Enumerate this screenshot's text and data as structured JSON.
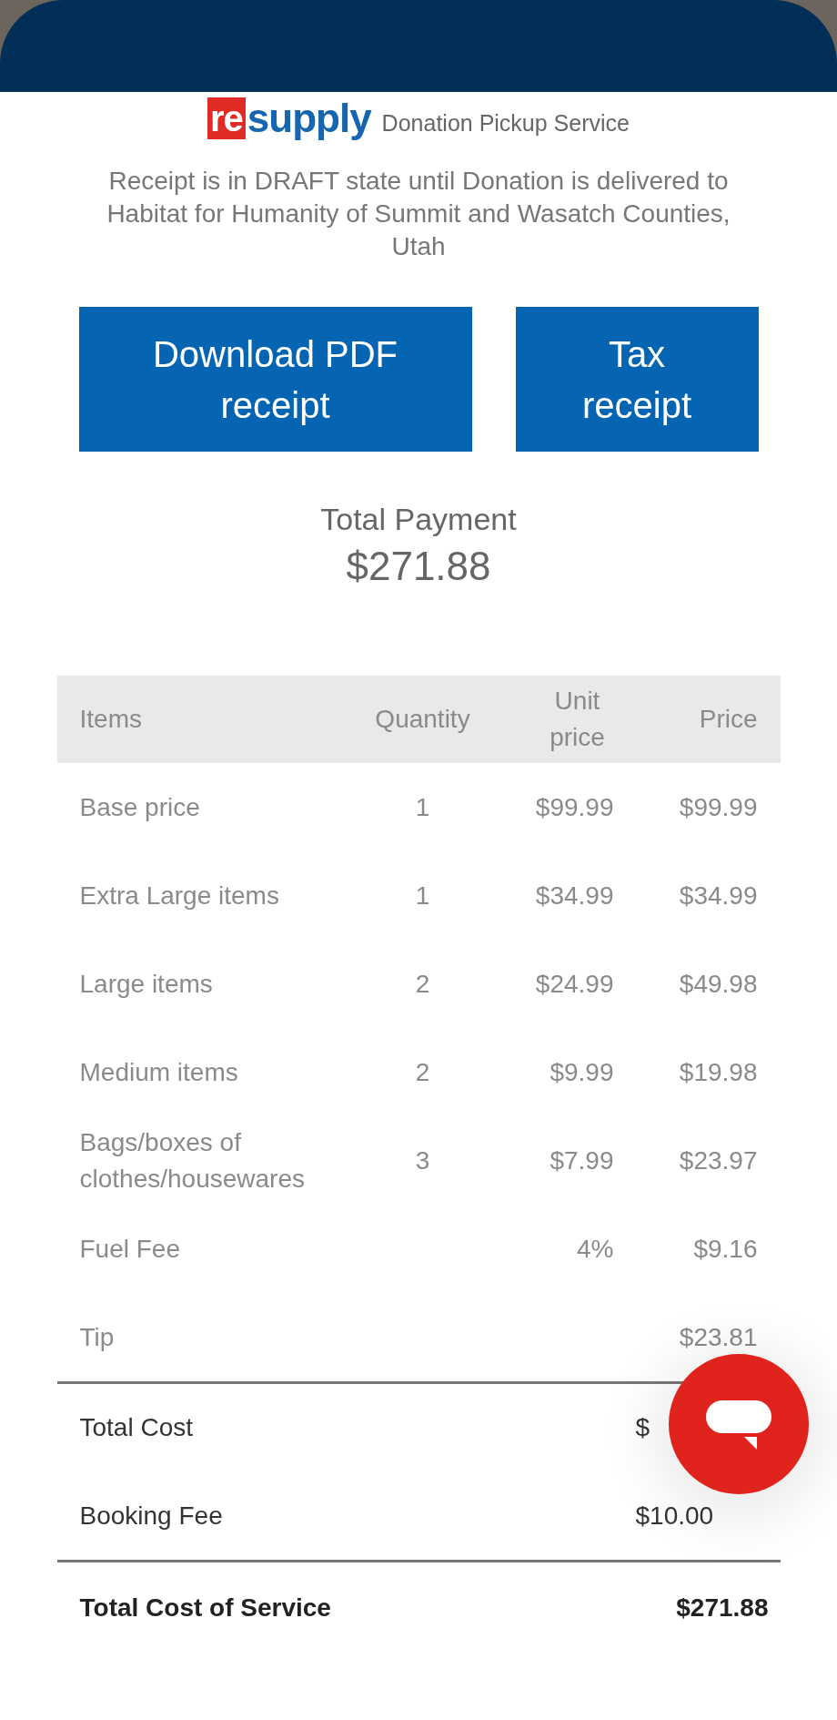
{
  "logo": {
    "mark": "re",
    "word": "supply",
    "tagline": "Donation Pickup Service"
  },
  "notice": "Receipt is in DRAFT state until Donation is delivered to Habitat for Humanity of Summit and Wasatch Counties, Utah",
  "buttons": [
    "Download PDF receipt",
    "Tax receipt"
  ],
  "total_payment": {
    "label": "Total Payment",
    "amount": "$271.88"
  },
  "table": {
    "columns": [
      "Items",
      "Quantity",
      "Unit price",
      "Price"
    ],
    "rows": [
      {
        "item": "Base price",
        "quantity": "1",
        "unit_price": "$99.99",
        "price": "$99.99"
      },
      {
        "item": "Extra Large items",
        "quantity": "1",
        "unit_price": "$34.99",
        "price": "$34.99"
      },
      {
        "item": "Large items",
        "quantity": "2",
        "unit_price": "$24.99",
        "price": "$49.98"
      },
      {
        "item": "Medium items",
        "quantity": "2",
        "unit_price": "$9.99",
        "price": "$19.98"
      },
      {
        "item": "Bags/boxes of clothes/housewares",
        "quantity": "3",
        "unit_price": "$7.99",
        "price": "$23.97"
      },
      {
        "item": "Fuel Fee",
        "unit_price": "4%",
        "price": "$9.16"
      },
      {
        "item": "Tip",
        "price": "$23.81"
      }
    ],
    "subtotals": [
      {
        "label": "Total Cost",
        "value": "$"
      },
      {
        "label": "Booking Fee",
        "value": "$10.00"
      }
    ],
    "grand_total": {
      "label": "Total Cost of Service",
      "value": "$271.88"
    }
  }
}
